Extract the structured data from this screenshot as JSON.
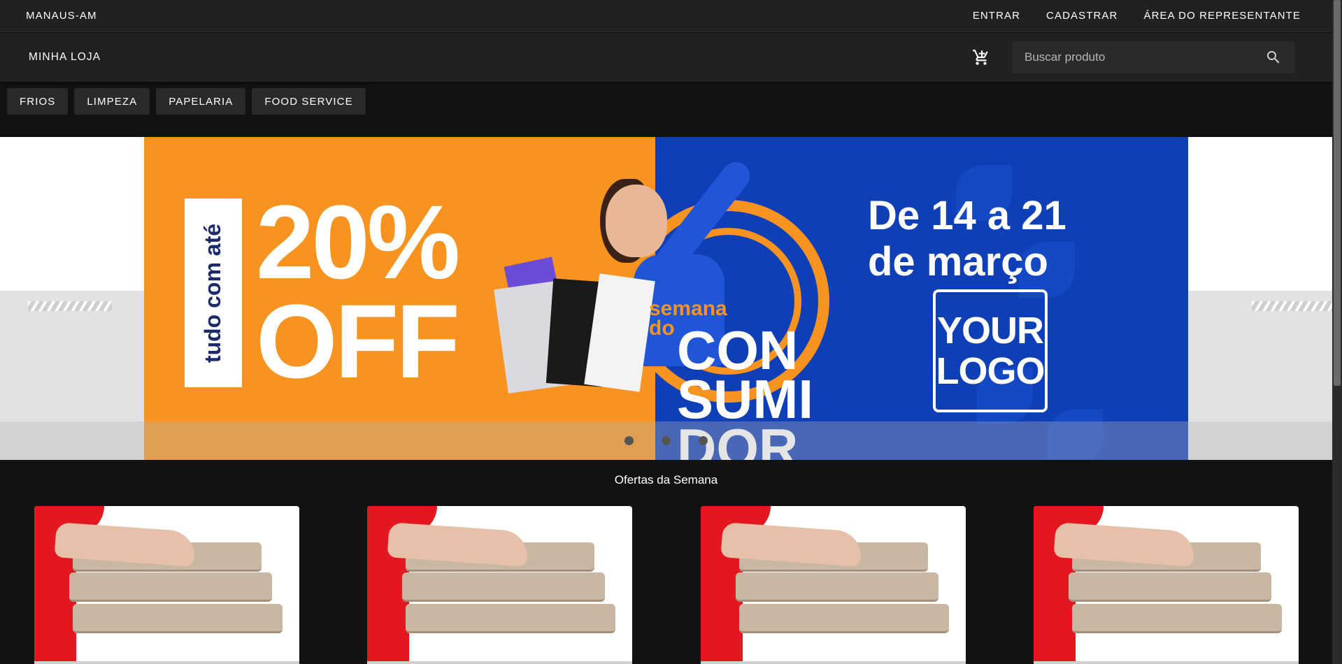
{
  "topbar": {
    "location": "MANAUS-AM",
    "links": [
      "ENTRAR",
      "CADASTRAR",
      "ÁREA DO REPRESENTANTE"
    ]
  },
  "toolbar": {
    "store_name": "MINHA LOJA",
    "cart_icon": "cart-icon",
    "search_placeholder": "Buscar produto",
    "search_icon": "search-icon"
  },
  "categories": [
    "FRIOS",
    "LIMPEZA",
    "PAPELARIA",
    "FOOD SERVICE"
  ],
  "banner": {
    "vertical_text": "tudo com até",
    "percent": "20%",
    "off": "OFF",
    "semana_line1": "semana",
    "semana_line2": "do",
    "consumi_line1": "CON",
    "consumi_line2": "SUMI",
    "consumi_line3": "DOR",
    "dates_line1": "De 14 a 21",
    "dates_line2": "de março",
    "logo_line1": "YOUR",
    "logo_line2": "LOGO",
    "slide_count": 3,
    "active_slide": 1,
    "colors": {
      "orange": "#f7931e",
      "blue": "#0f3fb6"
    }
  },
  "offers": {
    "title": "Ofertas da Semana",
    "cards": [
      {
        "image": "pizza-boxes-image"
      },
      {
        "image": "pizza-boxes-image"
      },
      {
        "image": "pizza-boxes-image"
      },
      {
        "image": "pizza-boxes-image"
      }
    ]
  }
}
